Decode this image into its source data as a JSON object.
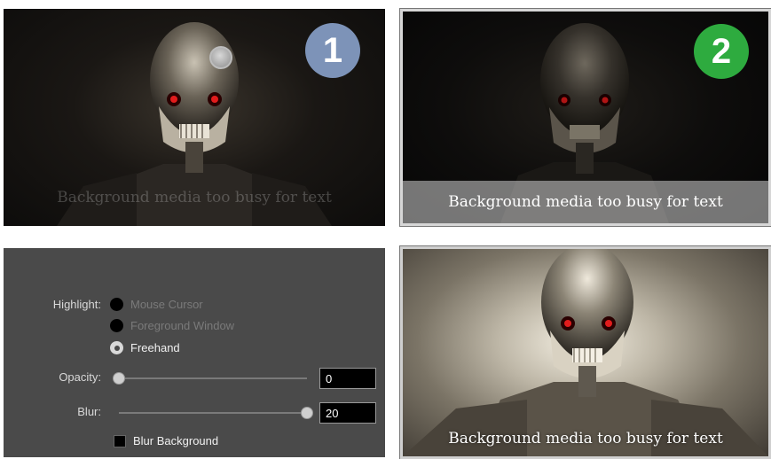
{
  "examples": {
    "step1_badge": "1",
    "step2_badge": "2",
    "caption_text": "Background media too busy for text"
  },
  "settings": {
    "highlight_label": "Highlight:",
    "highlight_options": [
      {
        "label": "Mouse Cursor",
        "selected": false,
        "enabled": false
      },
      {
        "label": "Foreground Window",
        "selected": false,
        "enabled": false
      },
      {
        "label": "Freehand",
        "selected": true,
        "enabled": true
      }
    ],
    "opacity_label": "Opacity:",
    "opacity_value": "0",
    "opacity_level": 0,
    "blur_label": "Blur:",
    "blur_value": "20",
    "blur_level": 1,
    "blur_background_label": "Blur Background",
    "blur_background_checked": false
  },
  "colors": {
    "step1_badge": "#7d93b8",
    "step2_badge": "#2eab3f",
    "settings_bg": "#4a4a4a"
  },
  "icons": [
    "cursor-highlight-icon"
  ]
}
